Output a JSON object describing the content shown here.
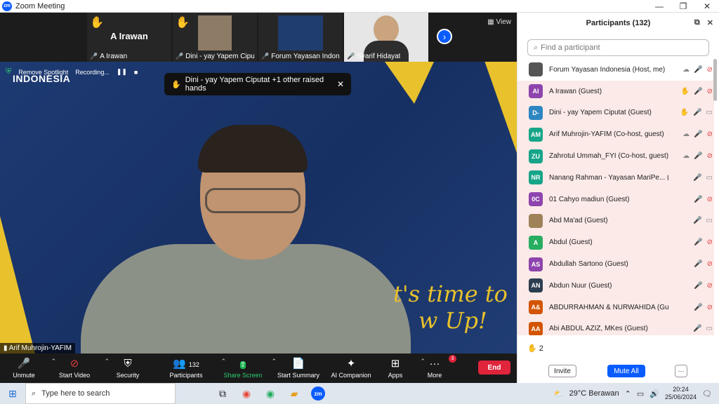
{
  "window": {
    "title": "Zoom Meeting",
    "app_icon": "zm",
    "controls": [
      "—",
      "❐",
      "✕"
    ]
  },
  "thumbnails": {
    "tiles": [
      {
        "name": "A Irawan",
        "big": "A Irawan",
        "hand": true
      },
      {
        "name": "Dini - yay Yapem Ciputat",
        "hand": true
      },
      {
        "name": "Forum Yayasan Indon...",
        "hand": false
      },
      {
        "name": "Syarif Hidayat",
        "hand": false
      }
    ],
    "view_label": "View"
  },
  "main": {
    "brand": "INDONESIA",
    "spotlight_bar": {
      "remove_spotlight": "Remove Spotlight",
      "recording": "Recording..."
    },
    "raised_banner": "Dini - yay Yapem  Ciputat +1 other raised hands",
    "slogan_line1": "t's time to",
    "slogan_line2": "w Up!",
    "speaker": "Arif Muhrojin-YAFIM"
  },
  "toolbar": {
    "unmute": "Unmute",
    "start_video": "Start Video",
    "security": "Security",
    "participants": "Participants",
    "participants_count": "132",
    "share_screen": "Share Screen",
    "start_summary": "Start Summary",
    "ai_companion": "AI Companion",
    "apps": "Apps",
    "more": "More",
    "more_badge": "3",
    "end": "End"
  },
  "panel": {
    "title": "Participants (132)",
    "search_placeholder": "Find a participant",
    "participants": [
      {
        "initials": "",
        "name": "Forum Yayasan Indonesia (Host, me)",
        "color": "#555555",
        "hl": false,
        "hand": false,
        "icons": [
          "cloud",
          "mic-off",
          "cam-off"
        ]
      },
      {
        "initials": "AI",
        "name": "A Irawan (Guest)",
        "color": "#8e44ad",
        "hl": true,
        "hand": true,
        "icons": [
          "hand",
          "mic-off",
          "cam-off"
        ]
      },
      {
        "initials": "D-",
        "name": "Dini - yay Yapem  Ciputat (Guest)",
        "color": "#2e86c1",
        "hl": true,
        "hand": true,
        "icons": [
          "hand",
          "mic-off",
          "cam"
        ]
      },
      {
        "initials": "AM",
        "name": "Arif Muhrojin-YAFIM (Co-host, guest)",
        "color": "#17a589",
        "hl": true,
        "hand": false,
        "icons": [
          "cloud",
          "mic",
          "cam-off"
        ]
      },
      {
        "initials": "ZU",
        "name": "Zahrotul Ummah_FYI (Co-host, guest)",
        "color": "#17a589",
        "hl": true,
        "hand": false,
        "icons": [
          "cloud",
          "mic",
          "cam-off"
        ]
      },
      {
        "initials": "NR",
        "name": "Nanang Rahman - Yayasan MariPe... (Guest)",
        "color": "#17a589",
        "hl": true,
        "hand": false,
        "icons": [
          "mic",
          "cam"
        ]
      },
      {
        "initials": "0C",
        "name": "01 Cahyo madiun (Guest)",
        "color": "#8e44ad",
        "hl": true,
        "hand": false,
        "icons": [
          "mic-off",
          "cam-off"
        ]
      },
      {
        "initials": "",
        "name": "Abd Ma'ad (Guest)",
        "color": "#a0825a",
        "hl": true,
        "hand": false,
        "icons": [
          "mic-off",
          "cam"
        ]
      },
      {
        "initials": "A",
        "name": "Abdul (Guest)",
        "color": "#27ae60",
        "hl": true,
        "hand": false,
        "icons": [
          "mic-off",
          "cam-off"
        ]
      },
      {
        "initials": "AS",
        "name": "Abdullah Sartono (Guest)",
        "color": "#8e44ad",
        "hl": true,
        "hand": false,
        "icons": [
          "mic-off",
          "cam-off"
        ]
      },
      {
        "initials": "AN",
        "name": "Abdun Nuur (Guest)",
        "color": "#2c3e50",
        "hl": true,
        "hand": false,
        "icons": [
          "mic-off",
          "cam-off"
        ]
      },
      {
        "initials": "A&",
        "name": "ABDURRAHMAN & NURWAHIDA (Guest)",
        "color": "#d35400",
        "hl": true,
        "hand": false,
        "icons": [
          "mic-off",
          "cam-off"
        ]
      },
      {
        "initials": "AA",
        "name": "Abi ABDUL AZIZ, MKes (Guest)",
        "color": "#d35400",
        "hl": true,
        "hand": false,
        "icons": [
          "mic-off",
          "cam"
        ]
      }
    ],
    "raised_hands_count": "2",
    "invite": "Invite",
    "mute_all": "Mute All",
    "more": "···"
  },
  "taskbar": {
    "search_placeholder": "Type here to search",
    "weather": "29°C  Berawan",
    "time": "20:24",
    "date": "25/06/2024"
  }
}
